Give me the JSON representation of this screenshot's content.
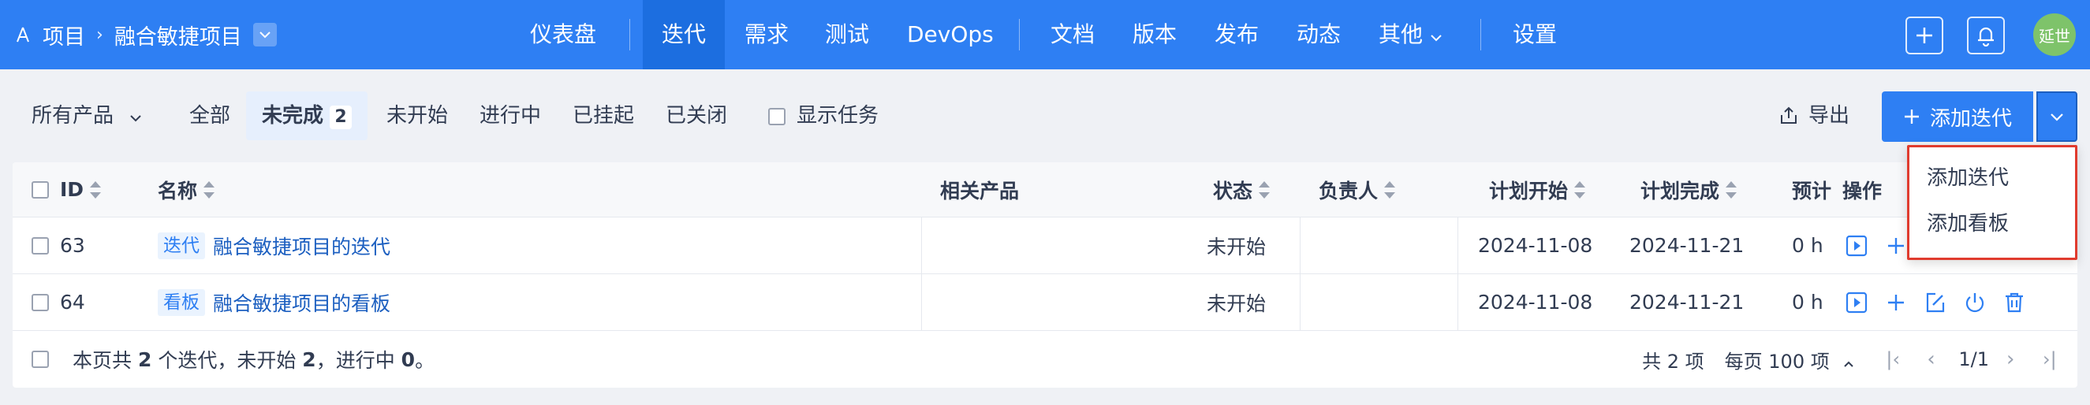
{
  "nav": {
    "crumb_root": "项目",
    "crumb_current": "融合敏捷项目",
    "items": [
      "仪表盘",
      "迭代",
      "需求",
      "测试",
      "DevOps",
      "文档",
      "版本",
      "发布",
      "动态",
      "其他",
      "设置"
    ],
    "active": "迭代",
    "avatar_text": "延世"
  },
  "toolbar": {
    "product_filter": "所有产品",
    "tabs": [
      {
        "label": "全部"
      },
      {
        "label": "未完成",
        "count": "2"
      },
      {
        "label": "未开始"
      },
      {
        "label": "进行中"
      },
      {
        "label": "已挂起"
      },
      {
        "label": "已关闭"
      }
    ],
    "show_tasks": "显示任务",
    "export": "导出",
    "add_iteration": "添加迭代"
  },
  "table": {
    "columns": {
      "id": "ID",
      "name": "名称",
      "product": "相关产品",
      "status": "状态",
      "owner": "负责人",
      "begin": "计划开始",
      "end": "计划完成",
      "estimate": "预计",
      "actions": "操作"
    },
    "rows": [
      {
        "id": "63",
        "tag": "迭代",
        "name": "融合敏捷项目的迭代",
        "product": "",
        "status": "未开始",
        "owner": "",
        "begin": "2024-11-08",
        "end": "2024-11-21",
        "estimate": "0 h"
      },
      {
        "id": "64",
        "tag": "看板",
        "name": "融合敏捷项目的看板",
        "product": "",
        "status": "未开始",
        "owner": "",
        "begin": "2024-11-08",
        "end": "2024-11-21",
        "estimate": "0 h"
      }
    ]
  },
  "footer": {
    "summary_prefix": "本页共",
    "summary_count": "2",
    "summary_mid": "个迭代，未开始",
    "summary_not_started": "2",
    "summary_mid2": "，进行中",
    "summary_in_progress": "0",
    "summary_end": "。",
    "total": "共 2 项",
    "per_page": "每页 100 项",
    "page": "1/1"
  },
  "dropdown": {
    "items": [
      "添加迭代",
      "添加看板"
    ]
  },
  "colors": {
    "primary": "#2e7ff3",
    "highlight_border": "#e03b2e"
  }
}
